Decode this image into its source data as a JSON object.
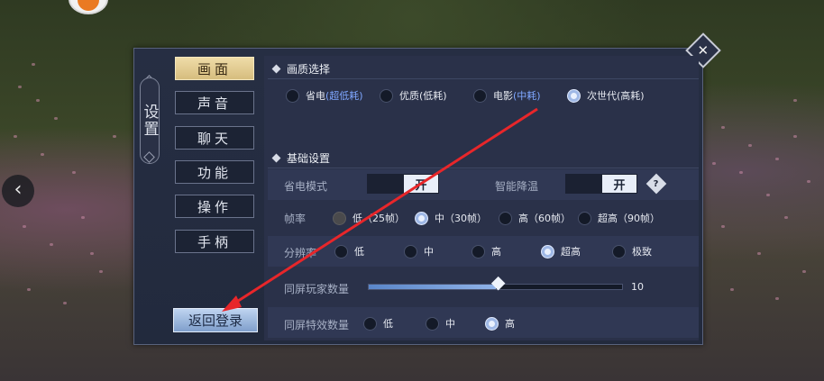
{
  "sidebar": {
    "title": "设置",
    "tabs": [
      {
        "label": "画面",
        "active": true
      },
      {
        "label": "声音",
        "active": false
      },
      {
        "label": "聊天",
        "active": false
      },
      {
        "label": "功能",
        "active": false
      },
      {
        "label": "操作",
        "active": false
      },
      {
        "label": "手柄",
        "active": false
      }
    ],
    "login_button": "返回登录"
  },
  "quality": {
    "title": "画质选择",
    "options": [
      {
        "label": "省电",
        "sub": "(超低耗)",
        "selected": false
      },
      {
        "label": "优质",
        "sub": "(低耗)",
        "selected": false
      },
      {
        "label": "电影",
        "sub": "(中耗)",
        "selected": false
      },
      {
        "label": "次世代",
        "sub": "(高耗)",
        "selected": true
      }
    ]
  },
  "basic": {
    "title": "基础设置",
    "power_mode": {
      "label": "省电模式",
      "value": "开"
    },
    "smart_cool": {
      "label": "智能降温",
      "value": "开"
    },
    "help_icon": "?",
    "framerate": {
      "label": "帧率",
      "options": [
        "低（25帧）",
        "中（30帧）",
        "高（60帧）",
        "超高（90帧）"
      ],
      "selected": 1
    },
    "resolution": {
      "label": "分辨率",
      "options": [
        "低",
        "中",
        "高",
        "超高",
        "极致"
      ],
      "selected": 3
    },
    "players": {
      "label": "同屏玩家数量",
      "value": 10,
      "max": 20
    },
    "effects": {
      "label": "同屏特效数量",
      "options": [
        "低",
        "中",
        "高"
      ],
      "selected": 2
    }
  },
  "close_symbol": "✕",
  "back_symbol": "‹",
  "accent_color": "#e8262a"
}
